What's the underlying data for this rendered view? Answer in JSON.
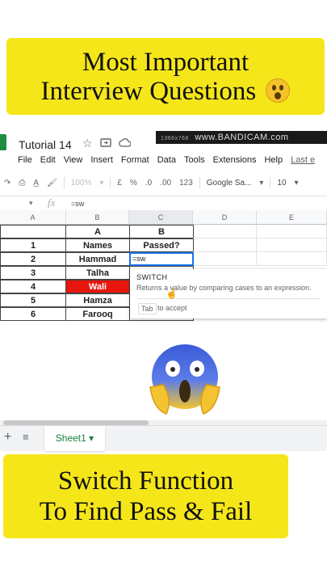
{
  "banner_top": {
    "line1": "Most Important",
    "line2": "Interview Questions"
  },
  "banner_bottom": {
    "line1": "Switch Function",
    "line2": "To Find Pass & Fail"
  },
  "colors": {
    "banner": "#f5e61a",
    "red_cell": "#e8160c",
    "sheets_green": "#188038",
    "select_blue": "#1a73e8"
  },
  "app": {
    "doc_title": "Tutorial 14",
    "title_icons": [
      "star-icon",
      "move-folder-icon",
      "cloud-status-icon"
    ],
    "recorder_small": "1366x768",
    "recorder_watermark": "www.BANDICAM.com"
  },
  "menu": [
    "File",
    "Edit",
    "View",
    "Insert",
    "Format",
    "Data",
    "Tools",
    "Extensions",
    "Help",
    "Last e"
  ],
  "toolbar": {
    "zoom": "100%",
    "currency": "£",
    "percent": "%",
    "dec_less": ".0",
    "dec_more": ".00",
    "format_more": "123",
    "font": "Google Sa...",
    "font_size": "10"
  },
  "formula_bar": {
    "fx": "fx",
    "content": "=sw"
  },
  "columns": [
    "A",
    "B",
    "C",
    "D",
    "E"
  ],
  "table": {
    "header_row": [
      "",
      "A",
      "B"
    ],
    "rows": [
      [
        "1",
        "Names",
        "Passed?"
      ],
      [
        "2",
        "Hammad",
        "=sw"
      ],
      [
        "3",
        "Talha",
        ""
      ],
      [
        "4",
        "Wali",
        ""
      ],
      [
        "5",
        "Hamza",
        ""
      ],
      [
        "6",
        "Farooq",
        ""
      ]
    ]
  },
  "autocomplete": {
    "function_name": "SWITCH",
    "description": "Returns a value by comparing cases to an expression.",
    "key": "Tab",
    "accept": "to accept"
  },
  "sheet_tab": {
    "label": "Sheet1",
    "add": "+",
    "all_sheets": "≡"
  }
}
